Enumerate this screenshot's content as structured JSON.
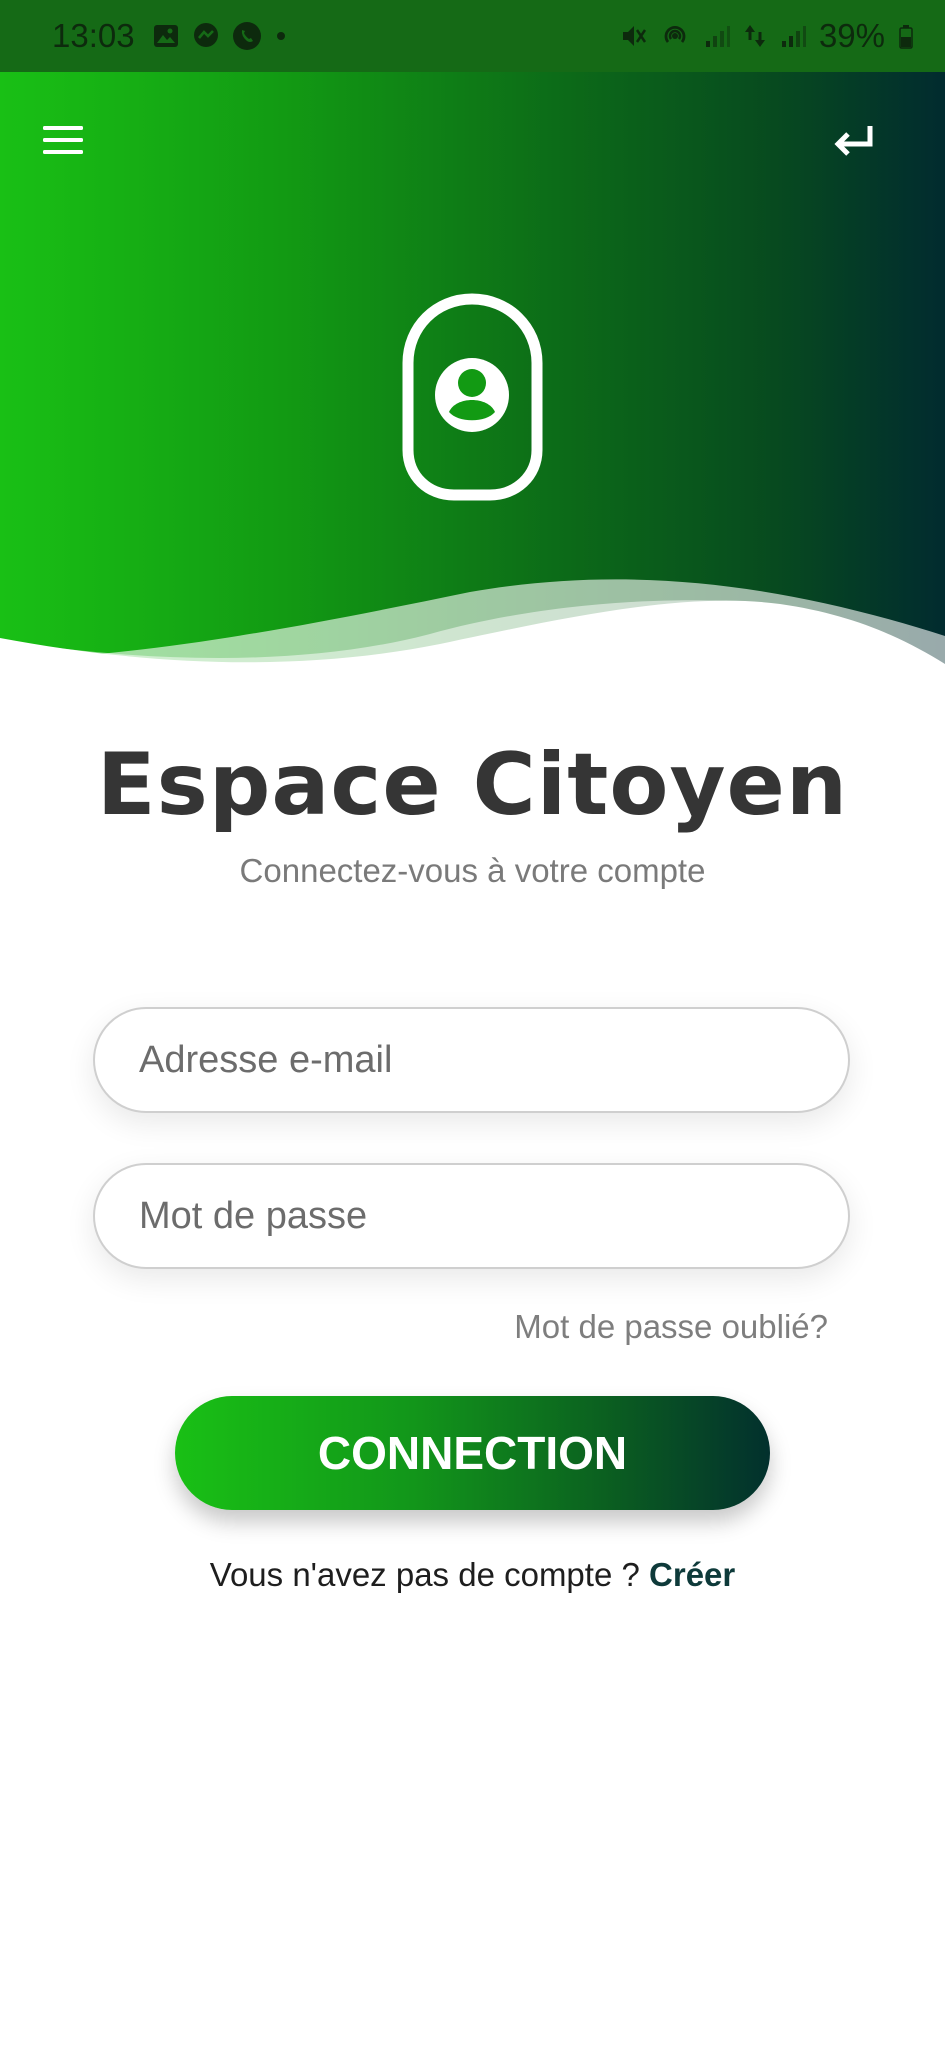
{
  "status_bar": {
    "time": "13:03",
    "battery": "39%",
    "icons": [
      "image-icon",
      "messenger-icon",
      "whatsapp-icon",
      "dot-icon",
      "mute-icon",
      "hotspot-icon",
      "signal-icon",
      "data-arrows-icon",
      "signal-icon",
      "battery-icon"
    ]
  },
  "header": {
    "menu_icon": "hamburger-menu-icon",
    "back_icon": "return-arrow-icon",
    "badge_icon": "user-badge-icon",
    "gradient_colors": [
      "#19c015",
      "#012b2f"
    ]
  },
  "title": "Espace Citoyen",
  "subtitle": "Connectez-vous à votre compte",
  "form": {
    "email_placeholder": "Adresse e-mail",
    "email_value": "",
    "password_placeholder": "Mot de passe",
    "password_value": "",
    "forgot_label": "Mot de passe oublié?",
    "submit_label": "CONNECTION"
  },
  "signup": {
    "prompt": "Vous n'avez pas de compte ?",
    "link_label": "Créer"
  },
  "colors": {
    "accent_green": "#19c015",
    "accent_dark": "#012b2f",
    "title_color": "#353535"
  }
}
